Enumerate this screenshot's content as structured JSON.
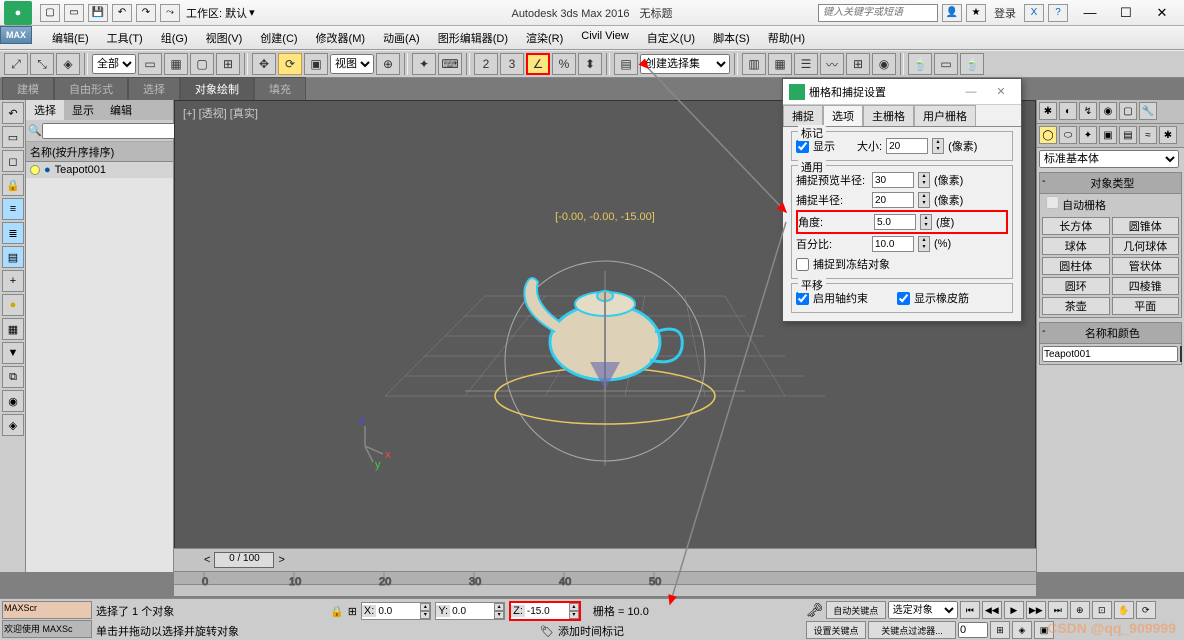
{
  "title": {
    "app": "Autodesk 3ds Max 2016",
    "doc": "无标题",
    "workspace_label": "工作区: 默认",
    "search_placeholder": "键入关键字或短语",
    "login": "登录"
  },
  "menu": [
    "编辑(E)",
    "工具(T)",
    "组(G)",
    "视图(V)",
    "创建(C)",
    "修改器(M)",
    "动画(A)",
    "图形编辑器(D)",
    "渲染(R)",
    "Civil View",
    "自定义(U)",
    "脚本(S)",
    "帮助(H)"
  ],
  "max_badge": "MAX",
  "toolbar": {
    "all": "全部",
    "view": "视图",
    "create_set": "创建选择集"
  },
  "ribbon_tabs": [
    "建模",
    "自由形式",
    "选择",
    "对象绘制",
    "填充"
  ],
  "scene_panel": {
    "tabs": [
      "选择",
      "显示",
      "编辑"
    ],
    "header": "名称(按升序排序)",
    "item": "Teapot001"
  },
  "viewport": {
    "label": "[+] [透视] [真实]",
    "coord": "[-0.00, -0.00, -15.00]"
  },
  "right_panel": {
    "dropdown": "标准基本体",
    "obj_type_title": "对象类型",
    "auto_grid": "自动栅格",
    "primitives": [
      "长方体",
      "圆锥体",
      "球体",
      "几何球体",
      "圆柱体",
      "管状体",
      "圆环",
      "四棱锥",
      "茶壶",
      "平面"
    ],
    "name_title": "名称和颜色",
    "name_value": "Teapot001"
  },
  "dialog": {
    "title": "栅格和捕捉设置",
    "tabs": [
      "捕捉",
      "选项",
      "主栅格",
      "用户栅格"
    ],
    "marker_group": "标记",
    "show": "显示",
    "size_label": "大小:",
    "size_val": "20",
    "size_unit": "(像素)",
    "gen_group": "通用",
    "snap_preview": "捕捉预览半径:",
    "snap_preview_val": "30",
    "snap_preview_unit": "(像素)",
    "snap_radius": "捕捉半径:",
    "snap_radius_val": "20",
    "snap_radius_unit": "(像素)",
    "angle": "角度:",
    "angle_val": "5.0",
    "angle_unit": "(度)",
    "percent": "百分比:",
    "percent_val": "10.0",
    "percent_unit": "(%)",
    "freeze": "捕捉到冻结对象",
    "trans_group": "平移",
    "axis_constr": "启用轴约束",
    "rubber": "显示橡皮筋"
  },
  "timeline": {
    "pos": "0 / 100"
  },
  "status": {
    "maxscr": "MAXScr",
    "welcome": "欢迎使用 MAXSc",
    "sel": "选择了 1 个对象",
    "hint": "单击并拖动以选择并旋转对象",
    "x": "0.0",
    "y": "0.0",
    "z": "-15.0",
    "grid": "栅格 = 10.0",
    "add_tag": "添加时间标记",
    "auto_key": "自动关键点",
    "selected": "选定对象",
    "set_key": "设置关键点",
    "key_filter": "关键点过滤器..."
  },
  "watermark": "CSDN @qq_909999"
}
